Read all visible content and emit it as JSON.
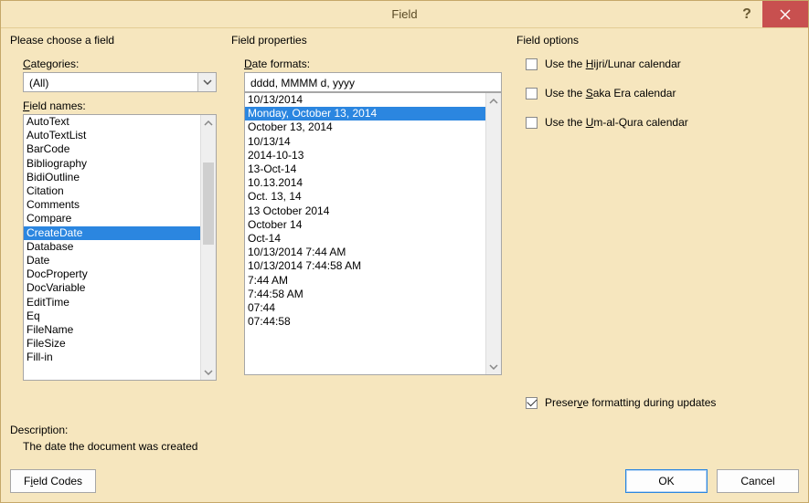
{
  "window": {
    "title": "Field"
  },
  "left": {
    "header": "Please choose a field",
    "categories_label": "Categories:",
    "categories_underline": "C",
    "categories_value": "(All)",
    "field_names_label": "Field names:",
    "field_names_underline": "F",
    "field_names": [
      "AutoText",
      "AutoTextList",
      "BarCode",
      "Bibliography",
      "BidiOutline",
      "Citation",
      "Comments",
      "Compare",
      "CreateDate",
      "Database",
      "Date",
      "DocProperty",
      "DocVariable",
      "EditTime",
      "Eq",
      "FileName",
      "FileSize",
      "Fill-in"
    ],
    "field_names_selected": "CreateDate"
  },
  "mid": {
    "header": "Field properties",
    "date_formats_label": "Date formats:",
    "date_formats_underline": "D",
    "date_formats_value": "dddd, MMMM d, yyyy",
    "date_items": [
      "10/13/2014",
      "Monday, October 13, 2014",
      "October 13, 2014",
      "10/13/14",
      "2014-10-13",
      "13-Oct-14",
      "10.13.2014",
      "Oct. 13, 14",
      "13 October 2014",
      "October 14",
      "Oct-14",
      "10/13/2014 7:44 AM",
      "10/13/2014 7:44:58 AM",
      "7:44 AM",
      "7:44:58 AM",
      "07:44",
      "07:44:58"
    ],
    "date_selected": "Monday, October 13, 2014"
  },
  "right": {
    "header": "Field options",
    "options": [
      {
        "label_pre": "Use the ",
        "u": "H",
        "label_post": "ijri/Lunar calendar",
        "checked": false
      },
      {
        "label_pre": "Use the ",
        "u": "S",
        "label_post": "aka Era calendar",
        "checked": false
      },
      {
        "label_pre": "Use the ",
        "u": "U",
        "label_post": "m-al-Qura calendar",
        "checked": false
      }
    ],
    "preserve_label_pre": "Preser",
    "preserve_u": "v",
    "preserve_label_post": "e formatting during updates",
    "preserve_checked": true
  },
  "desc": {
    "label": "Description:",
    "text": "The date the document was created"
  },
  "buttons": {
    "field_codes_pre": "F",
    "field_codes_u": "i",
    "field_codes_post": "eld Codes",
    "ok": "OK",
    "cancel": "Cancel"
  }
}
